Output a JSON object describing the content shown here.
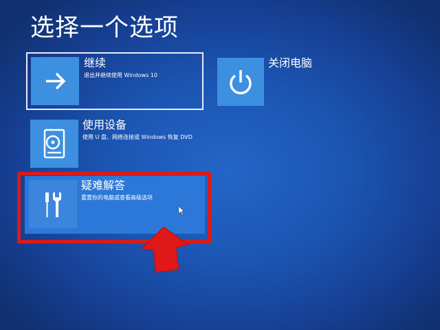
{
  "title": "选择一个选项",
  "options": [
    {
      "label": "继续",
      "description": "退出并继续使用 Windows 10",
      "icon": "arrow-right-icon"
    },
    {
      "label": "使用设备",
      "description": "使用 U 盘、网络连接或 Windows 恢复 DVD",
      "icon": "disc-drive-icon"
    },
    {
      "label": "疑难解答",
      "description": "重置你的电脑或查看高级选项",
      "icon": "tools-icon"
    }
  ],
  "shutdown": {
    "label": "关闭电脑",
    "icon": "power-icon"
  },
  "colors": {
    "background": "#1c56b4",
    "tile": "#3d8fe0",
    "highlight_border": "#d91b1b",
    "annotation_arrow": "#e01818"
  }
}
